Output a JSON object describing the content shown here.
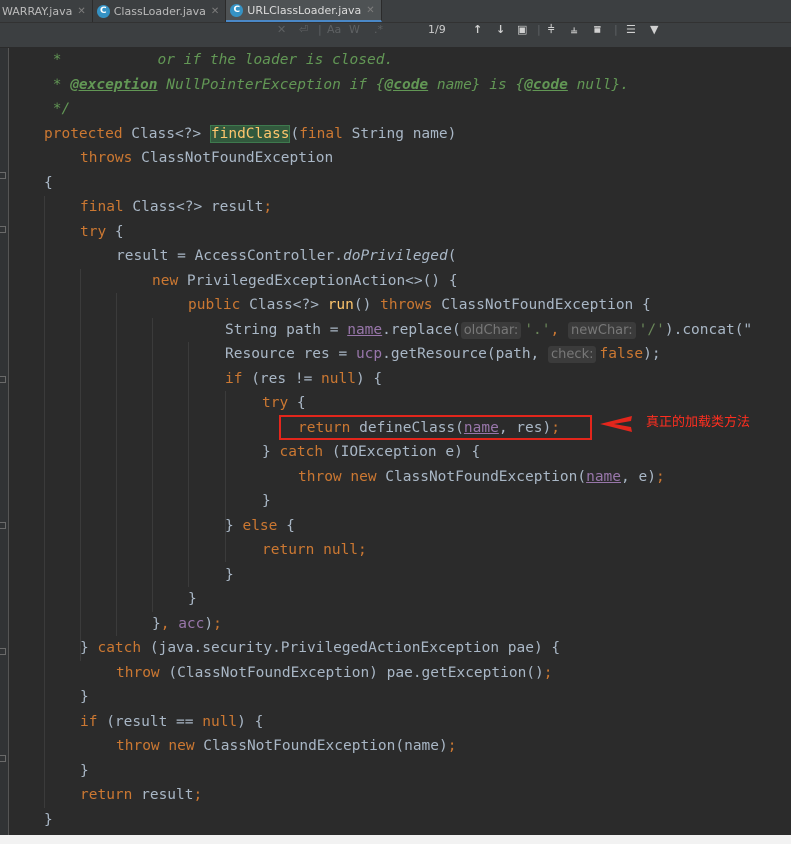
{
  "tabs": [
    {
      "label": "WARRAY.java",
      "active": false,
      "icon": "java-class-icon"
    },
    {
      "label": "ClassLoader.java",
      "active": false,
      "icon": "java-class-icon"
    },
    {
      "label": "URLClassLoader.java",
      "active": true,
      "icon": "java-class-icon"
    }
  ],
  "find_bar": {
    "match_case_label": "Aa",
    "words_label": "W",
    "regex_label": ".*",
    "match_count": "1/9"
  },
  "code": {
    "l1": {
      "a": " *           or if the loader is closed."
    },
    "l2": {
      "a": " * ",
      "b": "@exception",
      "c": " NullPointerException if {",
      "d": "@code",
      "e": " name} is {",
      "f": "@code",
      "g": " null}."
    },
    "l3": {
      "a": " */"
    },
    "l4": {
      "a": "protected",
      "b": " Class<?> ",
      "c": "findClass",
      "d": "(",
      "e": "final",
      "f": " String name)"
    },
    "l5": {
      "a": "throws",
      "b": " ClassNotFoundException"
    },
    "l6": {
      "a": "{"
    },
    "l7": {
      "a": "final",
      "b": " Class<?> result",
      "c": ";"
    },
    "l8": {
      "a": "try",
      "b": " {"
    },
    "l9": {
      "a": "result = AccessController.",
      "b": "doPrivileged",
      "c": "("
    },
    "l10": {
      "a": "new",
      "b": " PrivilegedExceptionAction<>() {"
    },
    "l11": {
      "a": "public",
      "b": " Class<?> ",
      "c": "run",
      "d": "() ",
      "e": "throws",
      "f": " ClassNotFoundException {"
    },
    "l12": {
      "a": "String path = ",
      "b": "name",
      "c": ".replace(",
      "h1": "oldChar:",
      "d": "'.'",
      "e": ", ",
      "h2": "newChar:",
      "f": "'/'",
      "g": ").concat(\""
    },
    "l13": {
      "a": "Resource res = ",
      "b": "ucp",
      "c": ".getResource(path, ",
      "h1": "check:",
      "d": "false",
      "e": ");"
    },
    "l14": {
      "a": "if",
      "b": " (res != ",
      "c": "null",
      "d": ") {"
    },
    "l15": {
      "a": "try",
      "b": " {"
    },
    "l16": {
      "a": "return",
      "b": " defineClass(",
      "c": "name",
      "d": ", res)",
      "e": ";"
    },
    "l17": {
      "a": "} ",
      "b": "catch",
      "c": " (IOException e) {"
    },
    "l18": {
      "a": "throw new",
      "b": " ClassNotFoundException(",
      "c": "name",
      "d": ", e)",
      "e": ";"
    },
    "l19": {
      "a": "}"
    },
    "l20": {
      "a": "} ",
      "b": "else",
      "c": " {"
    },
    "l21": {
      "a": "return null",
      "b": ";"
    },
    "l22": {
      "a": "}"
    },
    "l23": {
      "a": "}"
    },
    "l24": {
      "a": "}",
      "b": ", ",
      "c": "acc",
      "d": ")",
      "e": ";"
    },
    "l25": {
      "a": "} ",
      "b": "catch",
      "c": " (java.security.PrivilegedActionException pae) {"
    },
    "l26": {
      "a": "throw",
      "b": " (ClassNotFoundException) pae.getException()",
      "c": ";"
    },
    "l27": {
      "a": "}"
    },
    "l28": {
      "a": "if",
      "b": " (result == ",
      "c": "null",
      "d": ") {"
    },
    "l29": {
      "a": "throw new",
      "b": " ClassNotFoundException(name)",
      "c": ";"
    },
    "l30": {
      "a": "}"
    },
    "l31": {
      "a": "return",
      "b": " result",
      "c": ";"
    },
    "l32": {
      "a": "}"
    }
  },
  "annotation": {
    "text": "真正的加载类方法",
    "color": "#ff2e1f"
  },
  "colors": {
    "background": "#2b2b2b",
    "keyword": "#cc7832",
    "method": "#ffc66d",
    "field": "#9876aa",
    "string": "#6a8759",
    "doc_comment": "#629755"
  }
}
